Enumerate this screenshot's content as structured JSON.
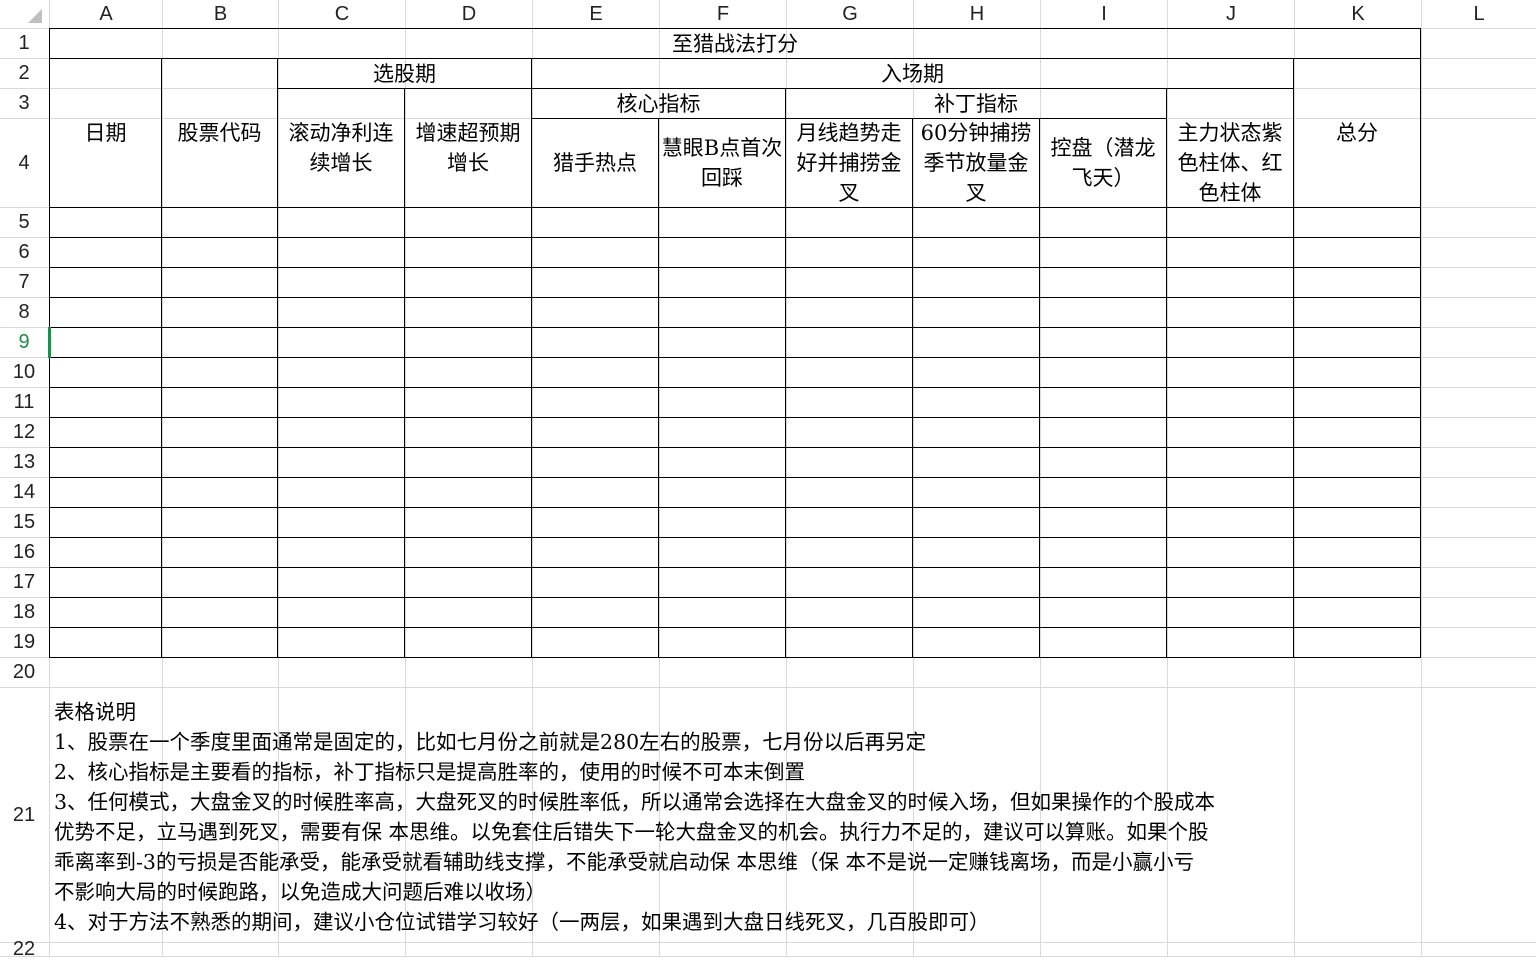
{
  "columns": [
    "A",
    "B",
    "C",
    "D",
    "E",
    "F",
    "G",
    "H",
    "I",
    "J",
    "K",
    "L"
  ],
  "rows": [
    "1",
    "2",
    "3",
    "4",
    "5",
    "6",
    "7",
    "8",
    "9",
    "10",
    "11",
    "12",
    "13",
    "14",
    "15",
    "16",
    "17",
    "18",
    "19",
    "20",
    "21",
    "22"
  ],
  "selected_row": "9",
  "table": {
    "title": "至猎战法打分",
    "date": "日期",
    "code": "股票代码",
    "select_period": "选股期",
    "entry_period": "入场期",
    "core": "核心指标",
    "patch": "补丁指标",
    "c4": "滚动净利连续增长",
    "d4": "增速超预期增长",
    "e4": "猎手热点",
    "f4": "慧眼B点首次回踩",
    "g4": "月线趋势走好并捕捞金叉",
    "h4": "60分钟捕捞季节放量金叉",
    "i4": "控盘（潜龙飞天）",
    "j4": "主力状态紫色柱体、红色柱体",
    "total": "总分"
  },
  "notes": {
    "title": "表格说明",
    "l1": "1、股票在一个季度里面通常是固定的，比如七月份之前就是280左右的股票，七月份以后再另定",
    "l2": "2、核心指标是主要看的指标，补丁指标只是提高胜率的，使用的时候不可本末倒置",
    "l3a": "3、任何模式，大盘金叉的时候胜率高，大盘死叉的时候胜率低，所以通常会选择在大盘金叉的时候入场，但如果操作的个股成本",
    "l3b": "优势不足，立马遇到死叉，需要有保 本思维。以免套住后错失下一轮大盘金叉的机会。执行力不足的，建议可以算账。如果个股",
    "l3c": "乖离率到-3的亏损是否能承受，能承受就看辅助线支撑，不能承受就启动保 本思维（保 本不是说一定赚钱离场，而是小赢小亏",
    "l3d": "不影响大局的时候跑路，以免造成大问题后难以收场）",
    "l4": "4、对于方法不熟悉的期间，建议小仓位试错学习较好（一两层，如果遇到大盘日线死叉，几百股即可）"
  }
}
